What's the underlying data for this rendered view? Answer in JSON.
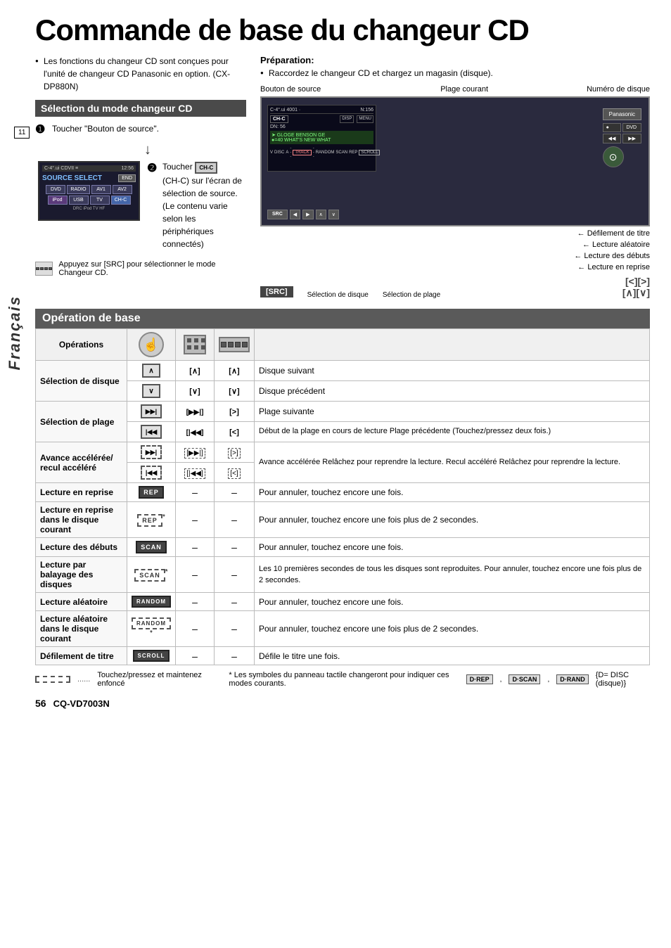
{
  "page": {
    "title": "Commande de base du changeur CD",
    "language_tab": "Français",
    "page_number": "56",
    "model": "CQ-VD7003N"
  },
  "top_left": {
    "bullets": [
      "Les fonctions du changeur CD sont conçues pour l'unité de changeur CD Panasonic en option. (CX-DP880N)"
    ],
    "section_header": "Sélection du mode changeur CD",
    "step1": {
      "num": "❶",
      "text": "Toucher \"Bouton de source\"."
    },
    "step2": {
      "num": "❷",
      "text_before": "Toucher",
      "btn_label": "CH-C",
      "text_after": "(CH-C) sur l'écran de sélection de source. (Le contenu varie selon les périphériques connectés)"
    },
    "note_text": "Appuyez sur [SRC] pour sélectionner le mode Changeur CD.",
    "screen": {
      "top_bar_left": "C-4°.ui CDVII",
      "top_bar_right": "12:56",
      "title": "SOURCE SELECT",
      "end_btn": "END",
      "row1": [
        "DVD",
        "RADIO",
        "AV1",
        "AV2"
      ],
      "row2": [
        "iPod",
        "USB",
        "TV",
        "CH-C"
      ],
      "row3": "DRC iPod TV HF"
    }
  },
  "top_right": {
    "prep_label": "Préparation:",
    "prep_bullet": "Raccordez le changeur CD et chargez un magasin (disque).",
    "bouton_source_label": "Bouton de source",
    "plage_courante": "Plage courant",
    "numero_disque": "Numéro de disque",
    "src_label": "[SRC]",
    "selection_disque": "Sélection de disque",
    "selection_plage": "Sélection de plage",
    "defilement": "Défilement de titre",
    "lecture_aleatoire": "Lecture aléatoire",
    "lecture_debuts": "Lecture des débuts",
    "lecture_reprise": "Lecture en reprise",
    "joystick_labels": [
      "[<][>]",
      "[∧][∨]"
    ]
  },
  "op_table": {
    "header": "Opération de base",
    "col_ops": "Opérations",
    "rows": [
      {
        "id": "selection-disque",
        "label": "Sélection de disque",
        "btn1_up": "∧",
        "btn1_dn": "∨",
        "btn2_up": "[∧]",
        "btn2_dn": "[∨]",
        "btn3_up": "[∧]",
        "btn3_dn": "[∨]",
        "desc_up": "Disque suivant",
        "desc_dn": "Disque précédent"
      },
      {
        "id": "selection-plage",
        "label": "Sélection de plage",
        "btn1_fwd": "▶▶|",
        "btn1_rev": "|◀◀",
        "btn2_fwd": "[▶▶|]",
        "btn2_rev": "[|◀◀]",
        "btn3_fwd": "[>]",
        "btn3_rev": "[<]",
        "desc_fwd": "Plage suivante",
        "desc_rev": "Début de la plage en cours de lecture\nPlage précédente (Touchez/pressez deux fois.)"
      },
      {
        "id": "avance-acceleree",
        "label": "Avance accélérée/\nrecul accéléré",
        "desc": "Avance accélérée\nRelâchez pour reprendre la lecture.\nRecul accéléré\nRelâchez pour reprendre la lecture."
      },
      {
        "id": "lecture-reprise",
        "label": "Lecture en reprise",
        "btn1": "REP",
        "desc": "Pour annuler, touchez encore une fois."
      },
      {
        "id": "lecture-reprise-disque",
        "label": "Lecture en reprise dans\nle disque courant",
        "btn1": "REP",
        "asterisk": "*",
        "desc": "Pour annuler, touchez encore une fois plus de 2 secondes."
      },
      {
        "id": "lecture-debuts",
        "label": "Lecture des débuts",
        "btn1": "SCAN",
        "desc": "Pour annuler, touchez encore une fois."
      },
      {
        "id": "lecture-balayage",
        "label": "Lecture par balayage\ndes disques",
        "btn1": "SCAN",
        "asterisk": "*",
        "desc": "Les 10 premières secondes de tous les disques sont reproduites.\nPour annuler, touchez encore une fois plus de 2 secondes."
      },
      {
        "id": "lecture-aleatoire",
        "label": "Lecture aléatoire",
        "btn1": "RANDOM",
        "desc": "Pour annuler, touchez encore une fois."
      },
      {
        "id": "lecture-aleatoire-disque",
        "label": "Lecture aléatoire dans\nle disque courant",
        "btn1": "RANDOM",
        "asterisk": "*",
        "desc": "Pour annuler, touchez encore une fois plus de 2 secondes."
      },
      {
        "id": "defilement-titre",
        "label": "Défilement de titre",
        "btn1": "SCROLL",
        "desc": "Défile le titre une fois."
      }
    ]
  },
  "footer": {
    "dashed_note": "Touchez/pressez et maintenez enfoncé",
    "asterisk_note": "* Les symboles du panneau tactile changeront pour indiquer ces modes courants.",
    "tags": [
      "D·REP",
      "D·SCAN",
      "D·RAND"
    ],
    "disc_note": "{D= DISC (disque)}"
  }
}
